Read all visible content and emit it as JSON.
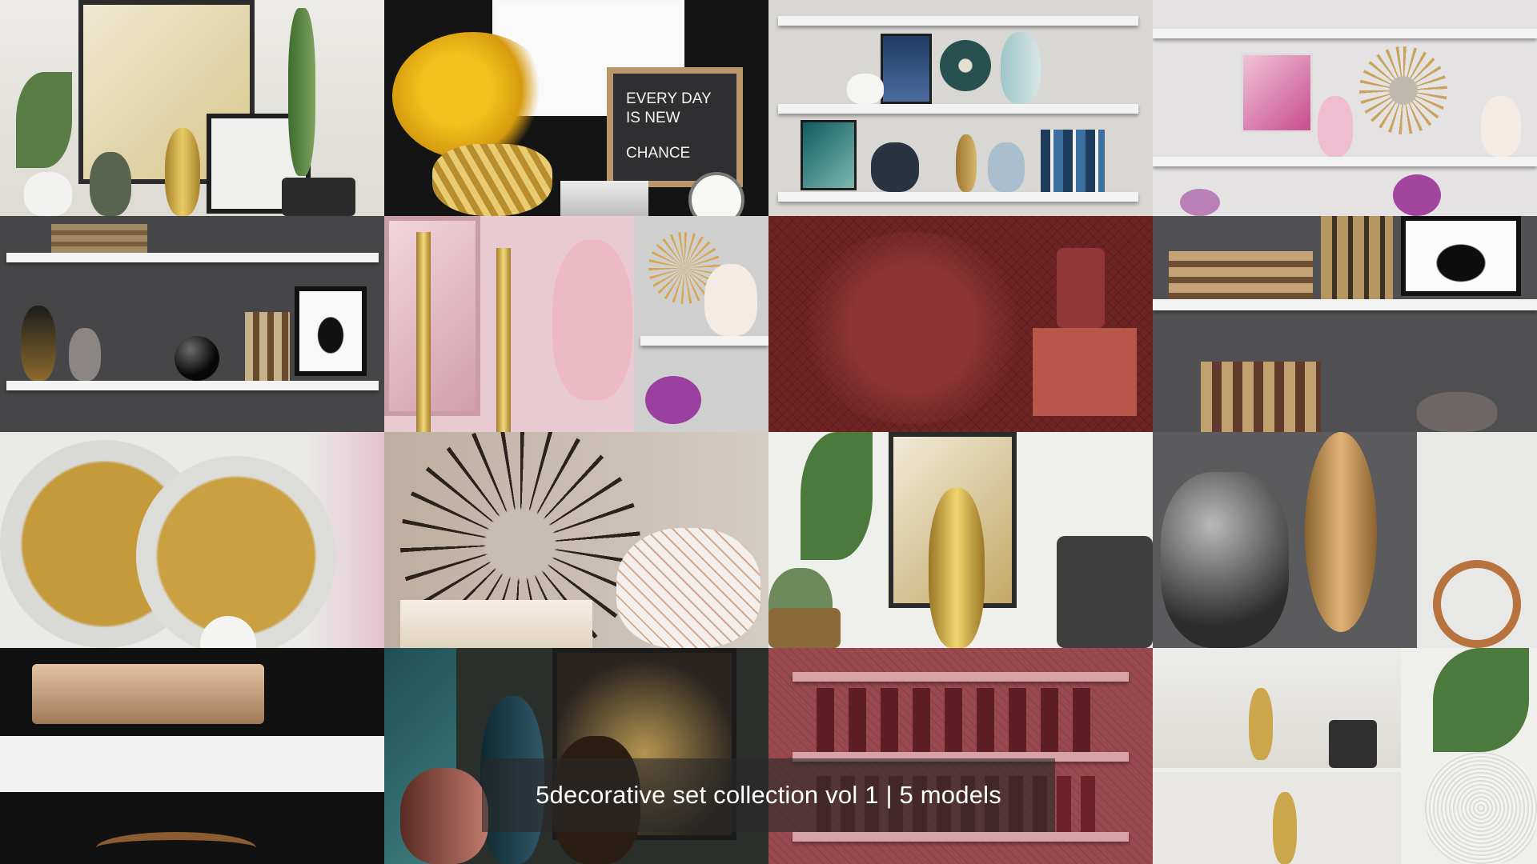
{
  "caption": {
    "title": "5decorative set collection vol 1 | 5 models"
  },
  "letter_board": {
    "line1": "EVERY DAY",
    "line2": "IS NEW",
    "line3": "CHANCE"
  },
  "colors": {
    "wall_light": "#e9e6e1",
    "wall_dark": "#4b4b4d",
    "wireframe_red": "#6f2424",
    "gold": "#c9a441",
    "pink": "#e9c6cf"
  }
}
